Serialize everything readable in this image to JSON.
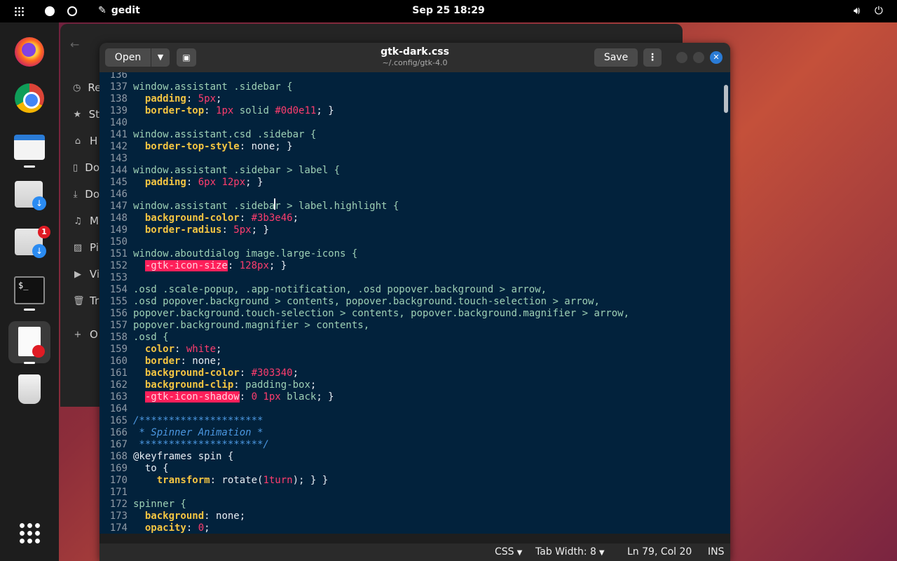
{
  "topbar": {
    "app_name": "gedit",
    "clock": "Sep 25  18:29"
  },
  "dock": {
    "badges": {
      "downloads2_count": "1"
    },
    "terminal_glyph": "$_"
  },
  "files_window": {
    "sidebar": [
      {
        "label": "Re",
        "icon": "clock-icon"
      },
      {
        "label": "St",
        "icon": "star-icon"
      },
      {
        "label": "H",
        "icon": "home-icon"
      },
      {
        "label": "Do",
        "icon": "document-icon"
      },
      {
        "label": "Do",
        "icon": "download-icon"
      },
      {
        "label": "M",
        "icon": "music-icon"
      },
      {
        "label": "Pi",
        "icon": "picture-icon"
      },
      {
        "label": "Vi",
        "icon": "video-icon"
      },
      {
        "label": "Tr",
        "icon": "trash-icon"
      },
      {
        "label": "O",
        "icon": "plus-icon"
      }
    ]
  },
  "gedit": {
    "open_label": "Open",
    "title": "gtk-dark.css",
    "path": "~/.config/gtk-4.0",
    "save_label": "Save",
    "statusbar": {
      "language": "CSS",
      "tab_width": "Tab Width: 8",
      "cursor": "Ln 79, Col 20",
      "mode": "INS"
    },
    "lines": [
      {
        "n": "136",
        "segs": []
      },
      {
        "n": "137",
        "segs": [
          [
            "sel",
            "window.assistant .sidebar {"
          ]
        ]
      },
      {
        "n": "138",
        "segs": [
          [
            "plain",
            "  "
          ],
          [
            "prop",
            "padding"
          ],
          [
            "plain",
            ": "
          ],
          [
            "val",
            "5px"
          ],
          [
            "plain",
            ";"
          ]
        ]
      },
      {
        "n": "139",
        "segs": [
          [
            "plain",
            "  "
          ],
          [
            "prop",
            "border-top"
          ],
          [
            "plain",
            ": "
          ],
          [
            "val",
            "1px"
          ],
          [
            "plain",
            " "
          ],
          [
            "sel",
            "solid"
          ],
          [
            "plain",
            " "
          ],
          [
            "val",
            "#0d0e11"
          ],
          [
            "plain",
            "; }"
          ]
        ]
      },
      {
        "n": "140",
        "segs": []
      },
      {
        "n": "141",
        "segs": [
          [
            "sel",
            "window.assistant.csd .sidebar {"
          ]
        ]
      },
      {
        "n": "142",
        "segs": [
          [
            "plain",
            "  "
          ],
          [
            "prop",
            "border-top-style"
          ],
          [
            "plain",
            ": none; }"
          ]
        ]
      },
      {
        "n": "143",
        "segs": []
      },
      {
        "n": "144",
        "segs": [
          [
            "sel",
            "window.assistant .sidebar > label {"
          ]
        ]
      },
      {
        "n": "145",
        "segs": [
          [
            "plain",
            "  "
          ],
          [
            "prop",
            "padding"
          ],
          [
            "plain",
            ": "
          ],
          [
            "val",
            "6px 12px"
          ],
          [
            "plain",
            "; }"
          ]
        ]
      },
      {
        "n": "146",
        "segs": []
      },
      {
        "n": "147",
        "segs": [
          [
            "sel",
            "window.assistant .sidebar > label.highlight {"
          ]
        ]
      },
      {
        "n": "148",
        "segs": [
          [
            "plain",
            "  "
          ],
          [
            "prop",
            "background-color"
          ],
          [
            "plain",
            ": "
          ],
          [
            "val",
            "#3b3e46"
          ],
          [
            "plain",
            ";"
          ]
        ]
      },
      {
        "n": "149",
        "segs": [
          [
            "plain",
            "  "
          ],
          [
            "prop",
            "border-radius"
          ],
          [
            "plain",
            ": "
          ],
          [
            "val",
            "5px"
          ],
          [
            "plain",
            "; }"
          ]
        ]
      },
      {
        "n": "150",
        "segs": []
      },
      {
        "n": "151",
        "segs": [
          [
            "sel",
            "window.aboutdialog image.large-icons {"
          ]
        ]
      },
      {
        "n": "152",
        "segs": [
          [
            "plain",
            "  "
          ],
          [
            "err",
            "-gtk-icon-size"
          ],
          [
            "plain",
            ": "
          ],
          [
            "val",
            "128px"
          ],
          [
            "plain",
            "; }"
          ]
        ]
      },
      {
        "n": "153",
        "segs": []
      },
      {
        "n": "154",
        "segs": [
          [
            "sel",
            ".osd .scale-popup, .app-notification, .osd popover.background > arrow,"
          ]
        ]
      },
      {
        "n": "155",
        "segs": [
          [
            "sel",
            ".osd popover.background > contents, popover.background.touch-selection > arrow,"
          ]
        ]
      },
      {
        "n": "156",
        "segs": [
          [
            "sel",
            "popover.background.touch-selection > contents, popover.background.magnifier > arrow,"
          ]
        ]
      },
      {
        "n": "157",
        "segs": [
          [
            "sel",
            "popover.background.magnifier > contents,"
          ]
        ]
      },
      {
        "n": "158",
        "segs": [
          [
            "sel",
            ".osd {"
          ]
        ]
      },
      {
        "n": "159",
        "segs": [
          [
            "plain",
            "  "
          ],
          [
            "prop",
            "color"
          ],
          [
            "plain",
            ": "
          ],
          [
            "val",
            "white"
          ],
          [
            "plain",
            ";"
          ]
        ]
      },
      {
        "n": "160",
        "segs": [
          [
            "plain",
            "  "
          ],
          [
            "prop",
            "border"
          ],
          [
            "plain",
            ": none;"
          ]
        ]
      },
      {
        "n": "161",
        "segs": [
          [
            "plain",
            "  "
          ],
          [
            "prop",
            "background-color"
          ],
          [
            "plain",
            ": "
          ],
          [
            "val",
            "#303340"
          ],
          [
            "plain",
            ";"
          ]
        ]
      },
      {
        "n": "162",
        "segs": [
          [
            "plain",
            "  "
          ],
          [
            "prop",
            "background-clip"
          ],
          [
            "plain",
            ": "
          ],
          [
            "sel",
            "padding-box"
          ],
          [
            "plain",
            ";"
          ]
        ]
      },
      {
        "n": "163",
        "segs": [
          [
            "plain",
            "  "
          ],
          [
            "err",
            "-gtk-icon-shadow"
          ],
          [
            "plain",
            ": "
          ],
          [
            "val",
            "0 1px"
          ],
          [
            "plain",
            " "
          ],
          [
            "sel",
            "black"
          ],
          [
            "plain",
            "; }"
          ]
        ]
      },
      {
        "n": "164",
        "segs": []
      },
      {
        "n": "165",
        "segs": [
          [
            "cmt",
            "/*********************"
          ]
        ]
      },
      {
        "n": "166",
        "segs": [
          [
            "cmt",
            " * Spinner Animation *"
          ]
        ]
      },
      {
        "n": "167",
        "segs": [
          [
            "cmt",
            " *********************/"
          ]
        ]
      },
      {
        "n": "168",
        "segs": [
          [
            "plain",
            "@keyframes spin {"
          ]
        ]
      },
      {
        "n": "169",
        "segs": [
          [
            "plain",
            "  to {"
          ]
        ]
      },
      {
        "n": "170",
        "segs": [
          [
            "plain",
            "    "
          ],
          [
            "prop",
            "transform"
          ],
          [
            "plain",
            ": rotate("
          ],
          [
            "val",
            "1turn"
          ],
          [
            "plain",
            "); } }"
          ]
        ]
      },
      {
        "n": "171",
        "segs": []
      },
      {
        "n": "172",
        "segs": [
          [
            "sel",
            "spinner {"
          ]
        ]
      },
      {
        "n": "173",
        "segs": [
          [
            "plain",
            "  "
          ],
          [
            "prop",
            "background"
          ],
          [
            "plain",
            ": none;"
          ]
        ]
      },
      {
        "n": "174",
        "segs": [
          [
            "plain",
            "  "
          ],
          [
            "prop",
            "opacity"
          ],
          [
            "plain",
            ": "
          ],
          [
            "val",
            "0"
          ],
          [
            "plain",
            ";"
          ]
        ]
      }
    ]
  }
}
